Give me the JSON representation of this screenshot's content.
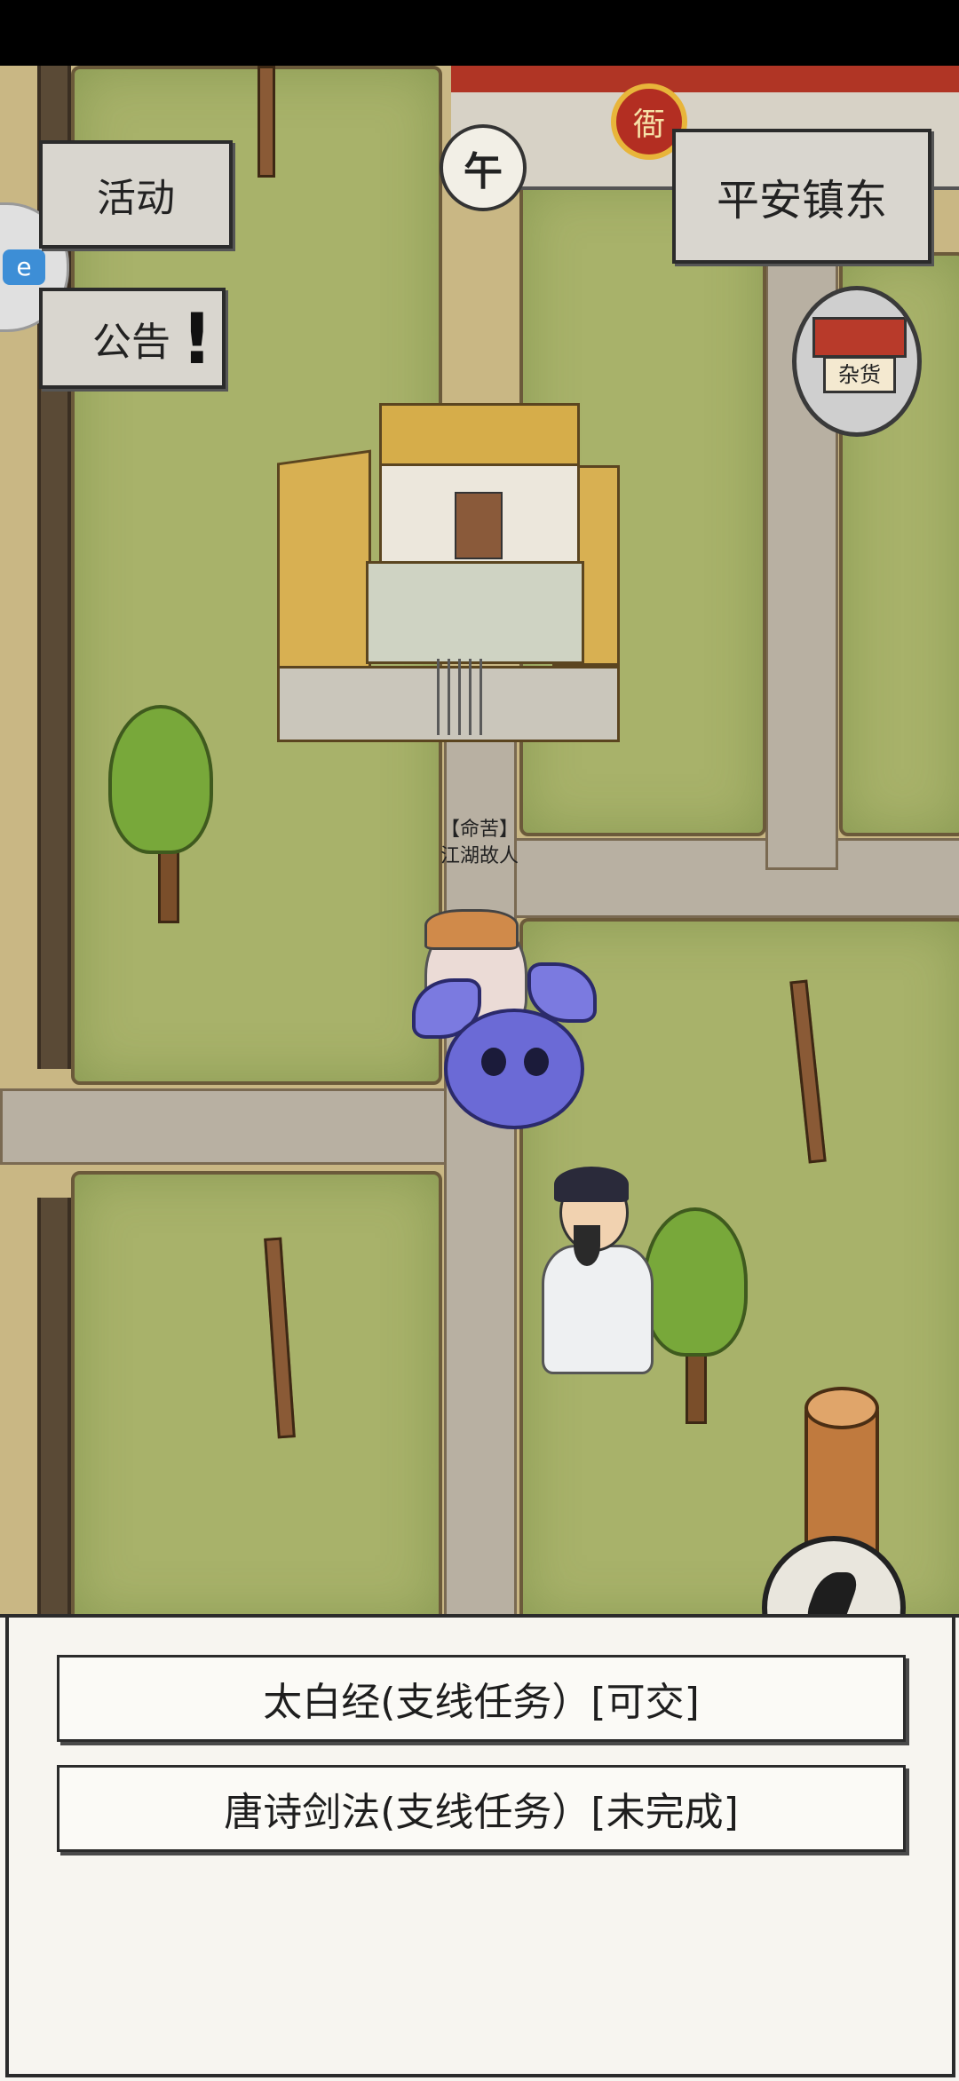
{
  "ui": {
    "activity_label": "活动",
    "announcement_label": "公告",
    "location_label": "平安镇东",
    "time_label": "午",
    "yamen_sign": "衙",
    "shop_sign": "杂货",
    "side_tab_glyph": "e"
  },
  "npc": {
    "title": "【命苦】",
    "name": "江湖故人"
  },
  "quests": [
    {
      "label": "太白经(支线任务）[可交]"
    },
    {
      "label": "唐诗剑法(支线任务）[未完成]"
    }
  ],
  "colors": {
    "grass": "#a8b26a",
    "road": "#b8b0a2",
    "panel_bg": "#f7f5f0",
    "yamen_red": "#b03525"
  }
}
